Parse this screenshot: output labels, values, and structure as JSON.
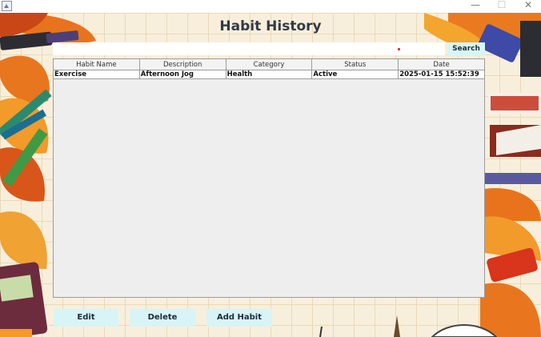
{
  "window": {
    "title": "",
    "controls": {
      "minimize": "—",
      "maximize": "☐",
      "close": "✕"
    }
  },
  "header": {
    "title": "Habit History"
  },
  "search": {
    "value": "",
    "button_label": "Search"
  },
  "table": {
    "columns": [
      "Habit Name",
      "Description",
      "Category",
      "Status",
      "Date"
    ],
    "rows": [
      {
        "habit_name": "Exercise",
        "description": "Afternoon Jog",
        "category": "Health",
        "status": "Active",
        "date": "2025-01-15 15:52:39"
      }
    ]
  },
  "actions": {
    "edit": "Edit",
    "delete": "Delete",
    "add_habit": "Add Habit"
  },
  "colors": {
    "button_bg": "#d9f4f6",
    "background": "#f7efdc",
    "grid_line": "#ead9b8",
    "leaf_orange": "#e86a1c"
  }
}
